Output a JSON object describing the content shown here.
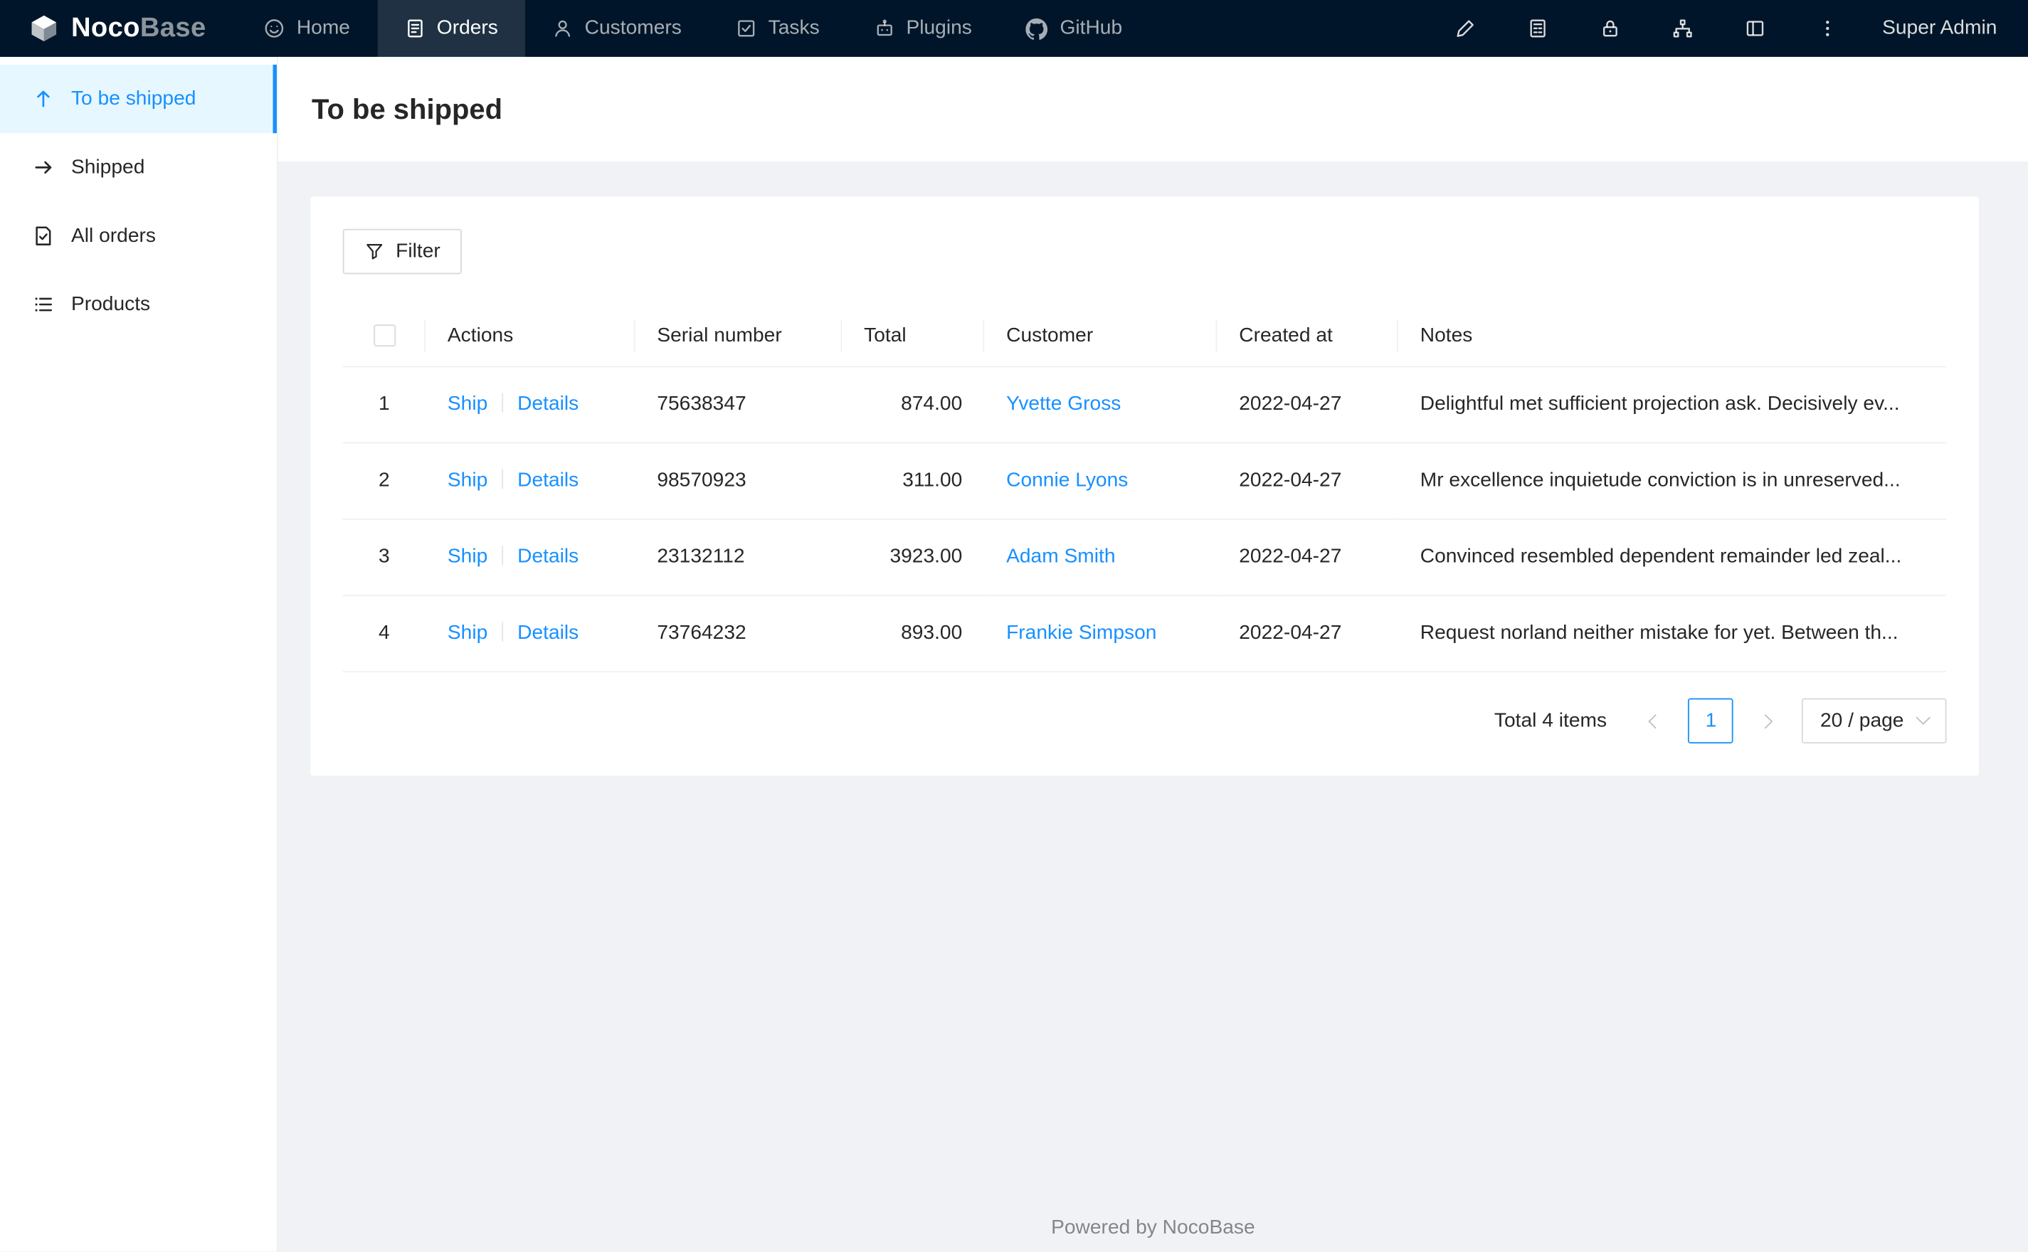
{
  "navbar": {
    "logo_noco": "Noco",
    "logo_base": "Base",
    "items": [
      {
        "label": "Home"
      },
      {
        "label": "Orders"
      },
      {
        "label": "Customers"
      },
      {
        "label": "Tasks"
      },
      {
        "label": "Plugins"
      },
      {
        "label": "GitHub"
      }
    ],
    "user_name": "Super Admin"
  },
  "sidebar": {
    "items": [
      {
        "label": "To be shipped"
      },
      {
        "label": "Shipped"
      },
      {
        "label": "All orders"
      },
      {
        "label": "Products"
      }
    ]
  },
  "page": {
    "title": "To be shipped"
  },
  "toolbar": {
    "filter_label": "Filter"
  },
  "table": {
    "headers": {
      "actions": "Actions",
      "serial": "Serial number",
      "total": "Total",
      "customer": "Customer",
      "created": "Created at",
      "notes": "Notes"
    },
    "actions": {
      "ship": "Ship",
      "details": "Details"
    },
    "rows": [
      {
        "index": "1",
        "serial": "75638347",
        "total": "874.00",
        "customer": "Yvette Gross",
        "created": "2022-04-27",
        "notes": "Delightful met sufficient projection ask. Decisively ev..."
      },
      {
        "index": "2",
        "serial": "98570923",
        "total": "311.00",
        "customer": "Connie Lyons",
        "created": "2022-04-27",
        "notes": "Mr excellence inquietude conviction is in unreserved..."
      },
      {
        "index": "3",
        "serial": "23132112",
        "total": "3923.00",
        "customer": "Adam Smith",
        "created": "2022-04-27",
        "notes": "Convinced resembled dependent remainder led zeal..."
      },
      {
        "index": "4",
        "serial": "73764232",
        "total": "893.00",
        "customer": "Frankie Simpson",
        "created": "2022-04-27",
        "notes": "Request norland neither mistake for yet. Between th..."
      }
    ]
  },
  "pagination": {
    "total_text": "Total 4 items",
    "page": "1",
    "page_size": "20 / page"
  },
  "footer": {
    "text": "Powered by NocoBase"
  },
  "colors": {
    "accent": "#1890ff",
    "navbar_bg": "#001529",
    "sidebar_active_bg": "#e6f7ff",
    "content_bg": "#f0f2f5",
    "border": "#f0f0f0",
    "button_border": "#d9d9d9"
  }
}
